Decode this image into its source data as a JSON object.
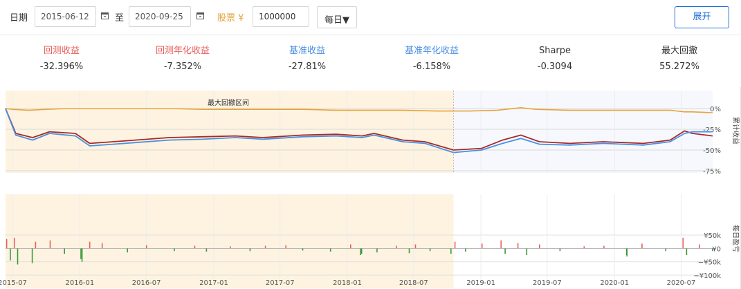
{
  "toolbar": {
    "date_label": "日期",
    "start_date": "2015-06-12",
    "to_label": "至",
    "end_date": "2020-09-25",
    "stock_label": "股票 ¥",
    "amount": "1000000",
    "frequency": "每日▼",
    "expand_label": "展开",
    "colors": {
      "accent": "#1e6fd9",
      "stock_label": "#e6a23c"
    }
  },
  "metrics": [
    {
      "label": "回测收益",
      "value": "-32.396%",
      "color": "#e8605c"
    },
    {
      "label": "回测年化收益",
      "value": "-7.352%",
      "color": "#e8605c"
    },
    {
      "label": "基准收益",
      "value": "-27.81%",
      "color": "#4a90e2"
    },
    {
      "label": "基准年化收益",
      "value": "-6.158%",
      "color": "#4a90e2"
    },
    {
      "label": "Sharpe",
      "value": "-0.3094",
      "color": "#333333"
    },
    {
      "label": "最大回撤",
      "value": "55.272%",
      "color": "#333333"
    }
  ],
  "chart_data": [
    {
      "type": "line",
      "annotation": "最大回撤区间",
      "drawdown_period": [
        "2015-06-12",
        "2018-10-18"
      ],
      "ylabel": "累计收益",
      "yticks": [
        "0%",
        "-25%",
        "-50%",
        "-75%"
      ],
      "ylim": [
        -75,
        0
      ],
      "grid": true,
      "series": [
        {
          "color": "#e8a33a",
          "x": [
            "2015-06-12",
            "2015-07-01",
            "2015-08-15",
            "2015-09-30",
            "2015-12-01",
            "2016-03-01",
            "2016-06-01",
            "2016-09-01",
            "2016-12-01",
            "2017-03-01",
            "2017-06-01",
            "2017-09-01",
            "2017-12-01",
            "2018-03-01",
            "2018-06-01",
            "2018-09-01",
            "2018-10-18",
            "2018-12-01",
            "2019-02-15",
            "2019-04-20",
            "2019-06-01",
            "2019-09-01",
            "2019-12-01",
            "2020-03-01",
            "2020-06-01",
            "2020-07-10",
            "2020-08-01",
            "2020-09-25"
          ],
          "values": [
            0,
            -1,
            -2,
            -1,
            0,
            0,
            0,
            0,
            -1,
            -1,
            -1,
            -1,
            -2,
            -2,
            -2,
            -3,
            -3,
            -3,
            -2,
            1,
            -1,
            -2,
            -2,
            -2,
            -2,
            -4,
            -4,
            -5
          ]
        },
        {
          "color": "#a52a2a",
          "x": [
            "2015-06-12",
            "2015-07-10",
            "2015-08-25",
            "2015-10-10",
            "2015-12-20",
            "2016-01-28",
            "2016-04-01",
            "2016-06-01",
            "2016-09-01",
            "2016-12-01",
            "2017-03-01",
            "2017-05-15",
            "2017-09-01",
            "2017-12-01",
            "2018-02-10",
            "2018-03-15",
            "2018-06-01",
            "2018-08-01",
            "2018-10-18",
            "2019-01-03",
            "2019-03-01",
            "2019-04-20",
            "2019-06-10",
            "2019-09-01",
            "2019-12-01",
            "2020-03-20",
            "2020-06-01",
            "2020-07-10",
            "2020-08-01",
            "2020-09-25"
          ],
          "values": [
            0,
            -30,
            -35,
            -28,
            -30,
            -42,
            -40,
            -38,
            -35,
            -34,
            -33,
            -35,
            -32,
            -31,
            -33,
            -30,
            -38,
            -40,
            -50,
            -48,
            -38,
            -32,
            -40,
            -42,
            -40,
            -42,
            -38,
            -27,
            -30,
            -33
          ]
        },
        {
          "color": "#4a90e2",
          "x": [
            "2015-06-12",
            "2015-07-10",
            "2015-08-25",
            "2015-10-10",
            "2015-12-20",
            "2016-01-28",
            "2016-04-01",
            "2016-06-01",
            "2016-09-01",
            "2016-12-01",
            "2017-03-01",
            "2017-05-15",
            "2017-09-01",
            "2017-12-01",
            "2018-02-10",
            "2018-03-15",
            "2018-06-01",
            "2018-08-01",
            "2018-10-18",
            "2019-01-03",
            "2019-03-01",
            "2019-04-20",
            "2019-06-10",
            "2019-09-01",
            "2019-12-01",
            "2020-03-20",
            "2020-06-01",
            "2020-07-10",
            "2020-08-01",
            "2020-09-25"
          ],
          "values": [
            0,
            -32,
            -38,
            -30,
            -33,
            -45,
            -43,
            -41,
            -38,
            -37,
            -35,
            -37,
            -34,
            -33,
            -35,
            -32,
            -40,
            -42,
            -53,
            -50,
            -42,
            -36,
            -43,
            -44,
            -42,
            -44,
            -40,
            -30,
            -28,
            -28
          ]
        }
      ]
    },
    {
      "type": "bar",
      "ylabel": "每日盈亏",
      "yticks": [
        "¥50k",
        "¥0",
        "−¥50k",
        "−¥100k"
      ],
      "ylim": [
        -100,
        50
      ],
      "unit": "k",
      "x_ticks": [
        "2015-07",
        "2016-01",
        "2016-07",
        "2017-01",
        "2017-07",
        "2018-01",
        "2018-07",
        "2019-01",
        "2019-07",
        "2020-01",
        "2020-07"
      ],
      "colors": {
        "positive": "#e8605c",
        "negative": "#3a9a3a"
      },
      "series": [
        {
          "x": [
            "2015-06-15",
            "2015-06-25",
            "2015-07-06",
            "2015-07-15",
            "2015-08-24",
            "2015-09-02",
            "2015-10-12",
            "2015-11-20",
            "2016-01-04",
            "2016-01-07",
            "2016-01-28",
            "2016-03-02",
            "2016-05-10",
            "2016-07-01",
            "2016-09-15",
            "2016-11-10",
            "2016-12-12",
            "2017-02-15",
            "2017-04-10",
            "2017-05-22",
            "2017-07-17",
            "2017-09-01",
            "2017-11-16",
            "2018-01-10",
            "2018-02-06",
            "2018-02-09",
            "2018-03-23",
            "2018-05-15",
            "2018-06-19",
            "2018-07-06",
            "2018-08-15",
            "2018-10-11",
            "2018-10-22",
            "2018-11-20",
            "2019-01-04",
            "2019-02-25",
            "2019-03-08",
            "2019-04-12",
            "2019-05-06",
            "2019-06-10",
            "2019-08-05",
            "2019-10-10",
            "2019-12-03",
            "2020-02-03",
            "2020-02-04",
            "2020-03-16",
            "2020-05-20",
            "2020-07-06",
            "2020-07-16",
            "2020-08-20",
            "2020-09-25"
          ],
          "values": [
            35,
            -45,
            40,
            -60,
            -55,
            25,
            30,
            -20,
            -40,
            -50,
            25,
            20,
            -15,
            12,
            -10,
            10,
            -12,
            8,
            -10,
            10,
            12,
            -8,
            -12,
            15,
            -25,
            -20,
            -15,
            10,
            -18,
            15,
            -10,
            -20,
            25,
            -12,
            18,
            30,
            -20,
            20,
            -25,
            15,
            -10,
            8,
            10,
            -25,
            -30,
            18,
            -10,
            40,
            -25,
            15,
            -10
          ]
        }
      ]
    }
  ]
}
